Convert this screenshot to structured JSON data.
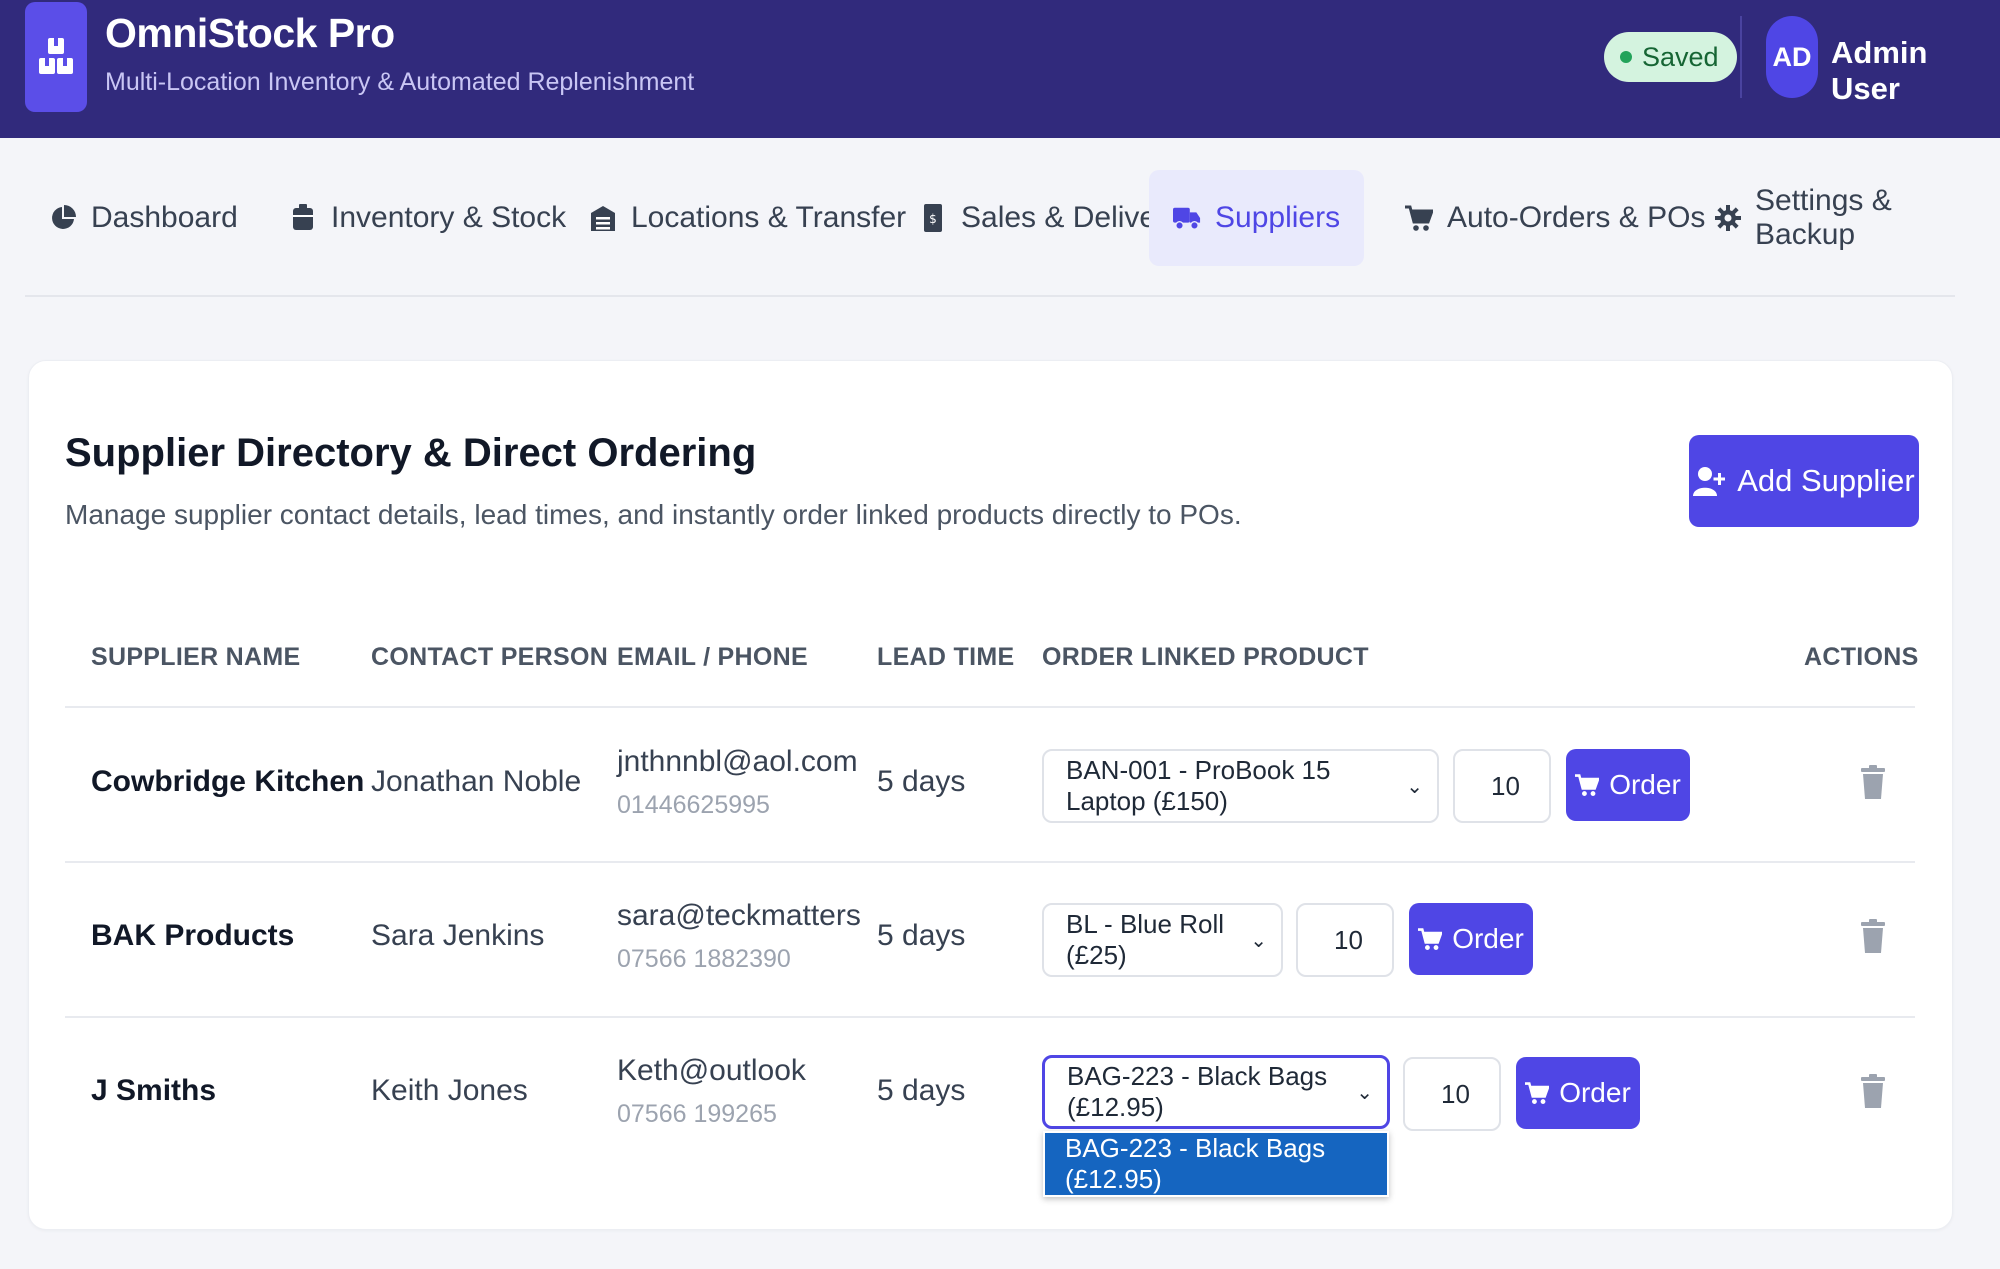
{
  "app": {
    "title": "OmniStock Pro",
    "subtitle": "Multi-Location Inventory & Automated Replenishment",
    "saved_label": "Saved",
    "user_initials": "AD",
    "user_name": "Admin User"
  },
  "nav": {
    "items": [
      {
        "label": "Dashboard",
        "icon": "pie-chart-icon",
        "active": false
      },
      {
        "label": "Inventory & Stock",
        "icon": "box-icon",
        "active": false
      },
      {
        "label": "Locations & Transfer",
        "icon": "warehouse-icon",
        "active": false
      },
      {
        "label": "Sales & Delivery",
        "icon": "receipt-icon",
        "active": false
      },
      {
        "label": "Suppliers",
        "icon": "truck-icon",
        "active": true
      },
      {
        "label": "Auto-Orders & POs",
        "icon": "cart-icon",
        "active": false
      },
      {
        "label": "Settings & Backup",
        "icon": "gear-icon",
        "active": false
      }
    ]
  },
  "page": {
    "title": "Supplier Directory & Direct Ordering",
    "subtitle": "Manage supplier contact details, lead times, and instantly order linked products directly to POs.",
    "add_button": "Add Supplier"
  },
  "table": {
    "headers": [
      "SUPPLIER NAME",
      "CONTACT PERSON",
      "EMAIL / PHONE",
      "LEAD TIME",
      "ORDER LINKED PRODUCT",
      "ACTIONS"
    ],
    "rows": [
      {
        "name": "Cowbridge Kitchen",
        "contact": "Jonathan Noble",
        "email": "jnthnnbl@aol.com",
        "phone": "01446625995",
        "lead_time": "5 days",
        "product": "BAN-001 - ProBook 15 Laptop (£150)",
        "qty": "10",
        "order_label": "Order"
      },
      {
        "name": "BAK Products",
        "contact": "Sara Jenkins",
        "email": "sara@teckmatters",
        "phone": "07566 1882390",
        "lead_time": "5 days",
        "product": "BL - Blue Roll (£25)",
        "qty": "10",
        "order_label": "Order"
      },
      {
        "name": "J Smiths",
        "contact": "Keith Jones",
        "email": "Keth@outlook",
        "phone": "07566 199265",
        "lead_time": "5 days",
        "product": "BAG-223 - Black Bags (£12.95)",
        "qty": "10",
        "order_label": "Order"
      }
    ],
    "dropdown_option": "BAG-223 - Black Bags (£12.95)"
  },
  "colors": {
    "header_bg": "#312a7c",
    "accent": "#4f46e5",
    "saved_bg": "#d4f3df",
    "dropdown_highlight": "#1565c0"
  }
}
